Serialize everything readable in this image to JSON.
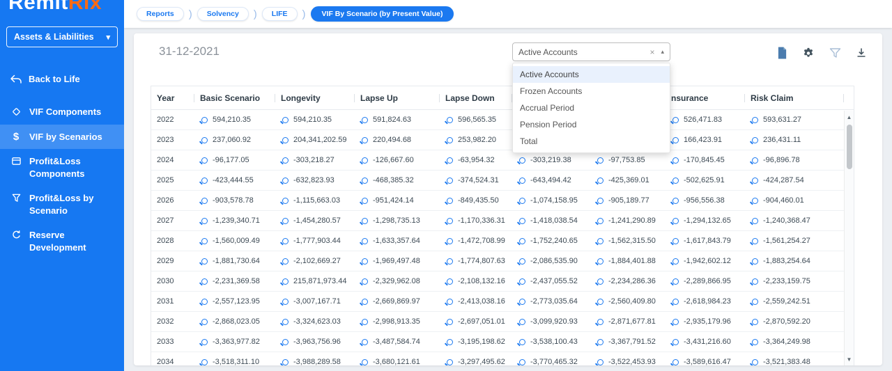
{
  "colors": {
    "sidebar_blue": "#1678f2",
    "accent_blue": "#1b79f0",
    "logo_orange": "#ff6a13",
    "option_highlight": "#e9f1fd"
  },
  "sidebar": {
    "logo": {
      "primary": "Remit",
      "accent": "Rix"
    },
    "module_select": {
      "value": "Assets & Liabilities"
    },
    "back_label": "Back to Life",
    "items": [
      {
        "id": "vif-components",
        "label": "VIF Components",
        "icon": "diamond-icon",
        "active": false
      },
      {
        "id": "vif-by-scenarios",
        "label": "VIF by Scenarios",
        "icon": "dollar-icon",
        "active": true
      },
      {
        "id": "profitloss-components",
        "label": "Profit&Loss Components",
        "icon": "folder-icon",
        "active": false
      },
      {
        "id": "profitloss-by-scenario",
        "label": "Profit&Loss by Scenario",
        "icon": "funnel-icon",
        "active": false
      },
      {
        "id": "reserve-development",
        "label": "Reserve Development",
        "icon": "refresh-icon",
        "active": false
      }
    ]
  },
  "breadcrumbs": {
    "separator": ")",
    "items": [
      {
        "label": "Reports",
        "active": false
      },
      {
        "label": "Solvency",
        "active": false
      },
      {
        "label": "LIFE",
        "active": false
      },
      {
        "label": "VIF By Scenario (by Present Value)",
        "active": true
      }
    ]
  },
  "main": {
    "date": "31-12-2021",
    "account_select": {
      "value": "Active Accounts",
      "options": [
        "Active Accounts",
        "Frozen Accounts",
        "Accrual Period",
        "Pension Period",
        "Total"
      ],
      "icons": [
        "clear-icon",
        "caret-up-icon"
      ]
    },
    "toolbar_icons": [
      "file-icon",
      "gear-icon",
      "filter-icon",
      "download-icon"
    ]
  },
  "table": {
    "columns": [
      "Year",
      "Basic Scenario",
      "Longevity",
      "Lapse Up",
      "Lapse Down",
      "",
      "",
      "nsurance",
      "Risk Claim"
    ],
    "rows": [
      {
        "year": "2022",
        "values": [
          "594,210.35",
          "594,210.35",
          "591,824.63",
          "596,565.35",
          null,
          null,
          "526,471.83",
          "593,631.27"
        ]
      },
      {
        "year": "2023",
        "values": [
          "237,060.92",
          "204,341,202.59",
          "220,494.68",
          "253,982.20",
          null,
          null,
          "166,423.91",
          "236,431.11"
        ]
      },
      {
        "year": "2024",
        "values": [
          "-96,177.05",
          "-303,218.27",
          "-126,667.60",
          "-63,954.32",
          "-303,219.38",
          "-97,753.85",
          "-170,845.45",
          "-96,896.78"
        ]
      },
      {
        "year": "2025",
        "values": [
          "-423,444.55",
          "-632,823.93",
          "-468,385.32",
          "-374,524.31",
          "-643,494.42",
          "-425,369.01",
          "-502,625.91",
          "-424,287.54"
        ]
      },
      {
        "year": "2026",
        "values": [
          "-903,578.78",
          "-1,115,663.03",
          "-951,424.14",
          "-849,435.50",
          "-1,074,158.95",
          "-905,189.77",
          "-956,556.38",
          "-904,460.01"
        ]
      },
      {
        "year": "2027",
        "values": [
          "-1,239,340.71",
          "-1,454,280.57",
          "-1,298,735.13",
          "-1,170,336.31",
          "-1,418,038.54",
          "-1,241,290.89",
          "-1,294,132.65",
          "-1,240,368.47"
        ]
      },
      {
        "year": "2028",
        "values": [
          "-1,560,009.49",
          "-1,777,903.44",
          "-1,633,357.64",
          "-1,472,708.99",
          "-1,752,240.65",
          "-1,562,315.50",
          "-1,617,843.79",
          "-1,561,254.27"
        ]
      },
      {
        "year": "2029",
        "values": [
          "-1,881,730.64",
          "-2,102,669.27",
          "-1,969,497.48",
          "-1,774,807.63",
          "-2,086,535.90",
          "-1,884,401.88",
          "-1,942,602.12",
          "-1,883,254.64"
        ]
      },
      {
        "year": "2030",
        "values": [
          "-2,231,369.58",
          "215,871,973.44",
          "-2,329,962.08",
          "-2,108,132.16",
          "-2,437,055.52",
          "-2,234,286.36",
          "-2,289,866.95",
          "-2,233,159.75"
        ]
      },
      {
        "year": "2031",
        "values": [
          "-2,557,123.95",
          "-3,007,167.71",
          "-2,669,869.97",
          "-2,413,038.16",
          "-2,773,035.64",
          "-2,560,409.80",
          "-2,618,984.23",
          "-2,559,242.51"
        ]
      },
      {
        "year": "2032",
        "values": [
          "-2,868,023.05",
          "-3,324,623.03",
          "-2,998,913.35",
          "-2,697,051.01",
          "-3,099,920.93",
          "-2,871,677.81",
          "-2,935,179.96",
          "-2,870,592.20"
        ]
      },
      {
        "year": "2033",
        "values": [
          "-3,363,977.82",
          "-3,963,756.96",
          "-3,487,584.74",
          "-3,195,198.62",
          "-3,538,100.43",
          "-3,367,791.52",
          "-3,431,216.60",
          "-3,364,249.98"
        ]
      },
      {
        "year": "2034",
        "values": [
          "-3,518,311.10",
          "-3,988,289.58",
          "-3,680,121.61",
          "-3,297,495.62",
          "-3,770,465.32",
          "-3,522,453.93",
          "-3,589,616.47",
          "-3,521,383.48"
        ]
      }
    ]
  },
  "scrollbar": {
    "up": "▲",
    "down": "▼"
  }
}
